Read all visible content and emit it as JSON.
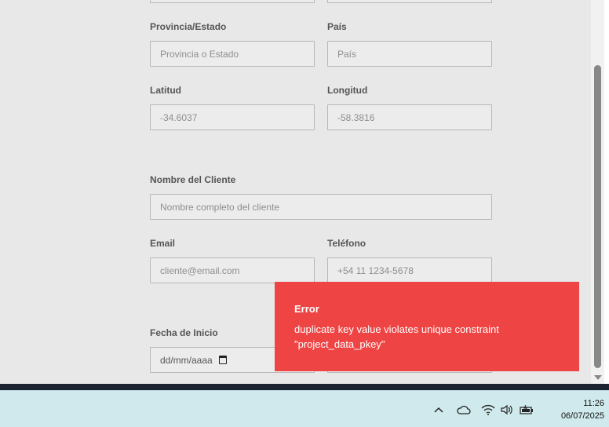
{
  "form": {
    "province": {
      "label": "Provincia/Estado",
      "placeholder": "Provincia o Estado"
    },
    "country": {
      "label": "País",
      "placeholder": "País"
    },
    "latitude": {
      "label": "Latitud",
      "placeholder": "-34.6037"
    },
    "longitude": {
      "label": "Longitud",
      "placeholder": "-58.3816"
    },
    "client_name": {
      "label": "Nombre del Cliente",
      "placeholder": "Nombre completo del cliente"
    },
    "email": {
      "label": "Email",
      "placeholder": "cliente@email.com"
    },
    "phone": {
      "label": "Teléfono",
      "placeholder": "+54 11 1234-5678"
    },
    "start_date": {
      "label": "Fecha de Inicio",
      "placeholder": "dd/mm/aaaa"
    }
  },
  "toast": {
    "title": "Error",
    "message": "duplicate key value violates unique constraint \"project_data_pkey\"",
    "color": "#ef4444"
  },
  "taskbar": {
    "time": "11:26",
    "date": "06/07/2025",
    "icons": [
      "chevron-up-icon",
      "cloud-icon",
      "wifi-icon",
      "speaker-icon",
      "battery-icon"
    ]
  }
}
